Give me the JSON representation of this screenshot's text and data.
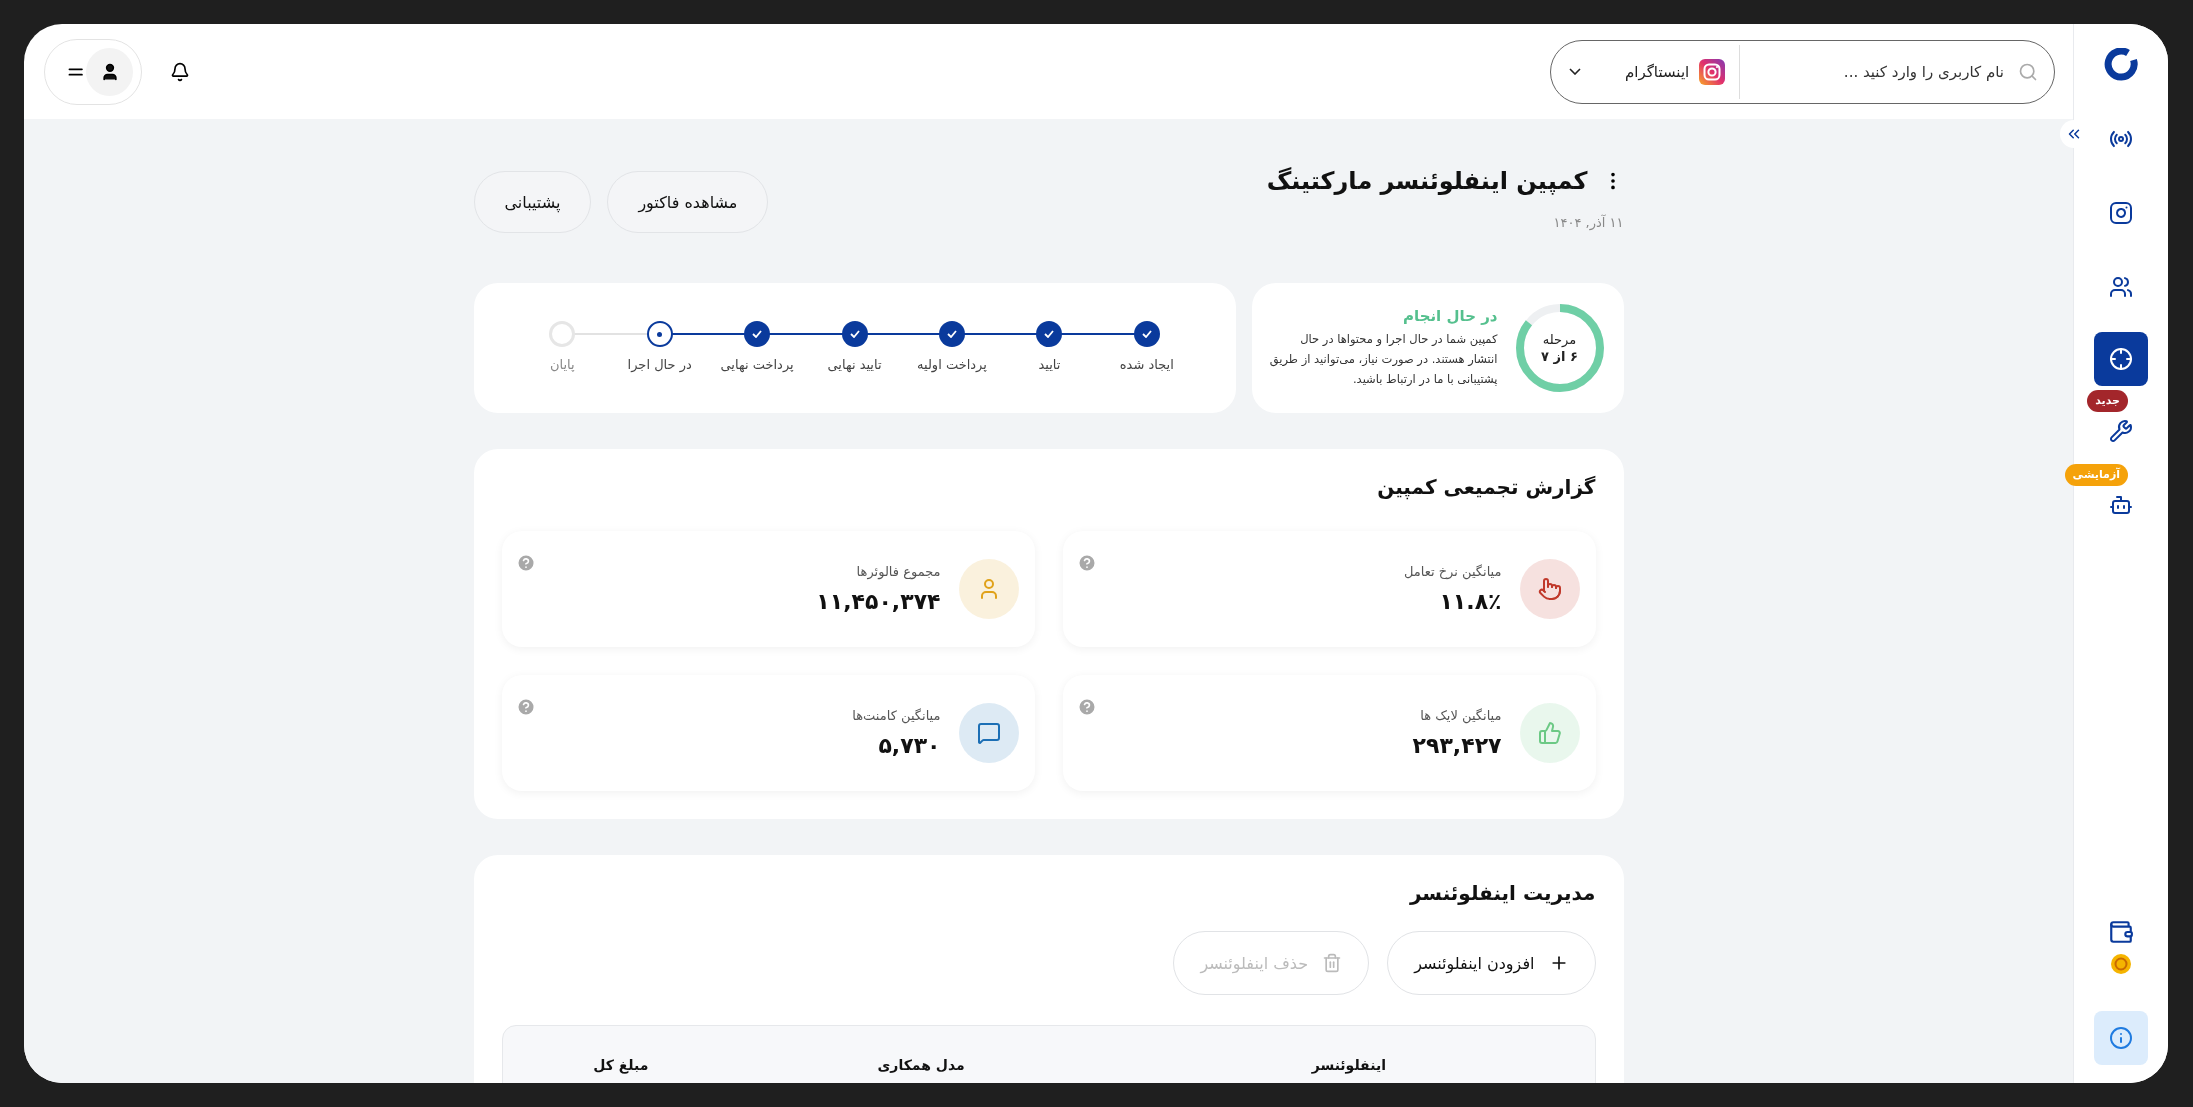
{
  "sidebar": {
    "items": [
      {
        "selected": false
      },
      {
        "selected": false
      },
      {
        "selected": false
      },
      {
        "selected": true
      },
      {
        "selected": false,
        "badge": {
          "label": "جدید",
          "color": "#a3262b"
        }
      },
      {
        "selected": false,
        "badge": {
          "label": "آزمایشی",
          "color": "#f5a20a"
        }
      }
    ]
  },
  "topbar": {
    "search": {
      "placeholder": "نام کاربری را وارد کنید ..."
    },
    "platform": {
      "label": "اینستاگرام"
    }
  },
  "header": {
    "title": "کمپین اینفلوئنسر مارکتینگ",
    "date": "۱۱ آذر, ۱۴۰۴",
    "buttons": [
      "مشاهده فاکتور",
      "پشتیبانی"
    ]
  },
  "status": {
    "ring_label": "مرحله",
    "ring_value": "۶ از ۷",
    "level": 0.857,
    "title": "در حال انجام",
    "text": "کمپین شما در حال اجرا و محتواها در حال انتشار هستند. در صورت نیاز، می‌توانید از طریق پشتیبانی با ما در ارتباط باشید."
  },
  "steps": [
    {
      "label": "ایجاد شده",
      "done": true,
      "current": false
    },
    {
      "label": "تایید",
      "done": true,
      "current": false
    },
    {
      "label": "پرداخت اولیه",
      "done": true,
      "current": false
    },
    {
      "label": "تایید نهایی",
      "done": true,
      "current": false
    },
    {
      "label": "پرداخت نهایی",
      "done": true,
      "current": false
    },
    {
      "label": "در حال اجرا",
      "done": false,
      "current": true
    },
    {
      "label": "پایان",
      "done": false,
      "current": false
    }
  ],
  "report": {
    "title": "گزارش تجمیعی کمپین",
    "stats": [
      {
        "label": "میانگین نرخ تعامل",
        "value": "۱۱.۸٪",
        "color": "#c0392b"
      },
      {
        "label": "مجموع فالوئرها",
        "value": "۱۱,۴۵۰,۳۷۴",
        "color": "#e0a21a"
      },
      {
        "label": "میانگین لایک ها",
        "value": "۲۹۳,۴۲۷",
        "color": "#6cc985"
      },
      {
        "label": "میانگین کامنت‌ها",
        "value": "۵,۷۳۰",
        "color": "#1c6fb5"
      }
    ]
  },
  "influencers": {
    "title": "مدیریت اینفلوئنسر",
    "buttons": [
      {
        "label": "افزودن اینفلوئنسر",
        "disabled": false
      },
      {
        "label": "حذف اینفلوئنسر",
        "disabled": true
      }
    ],
    "table": {
      "columns": [
        "اینفلوئنسر",
        "مدل همکاری",
        "مبلغ کل"
      ]
    }
  }
}
